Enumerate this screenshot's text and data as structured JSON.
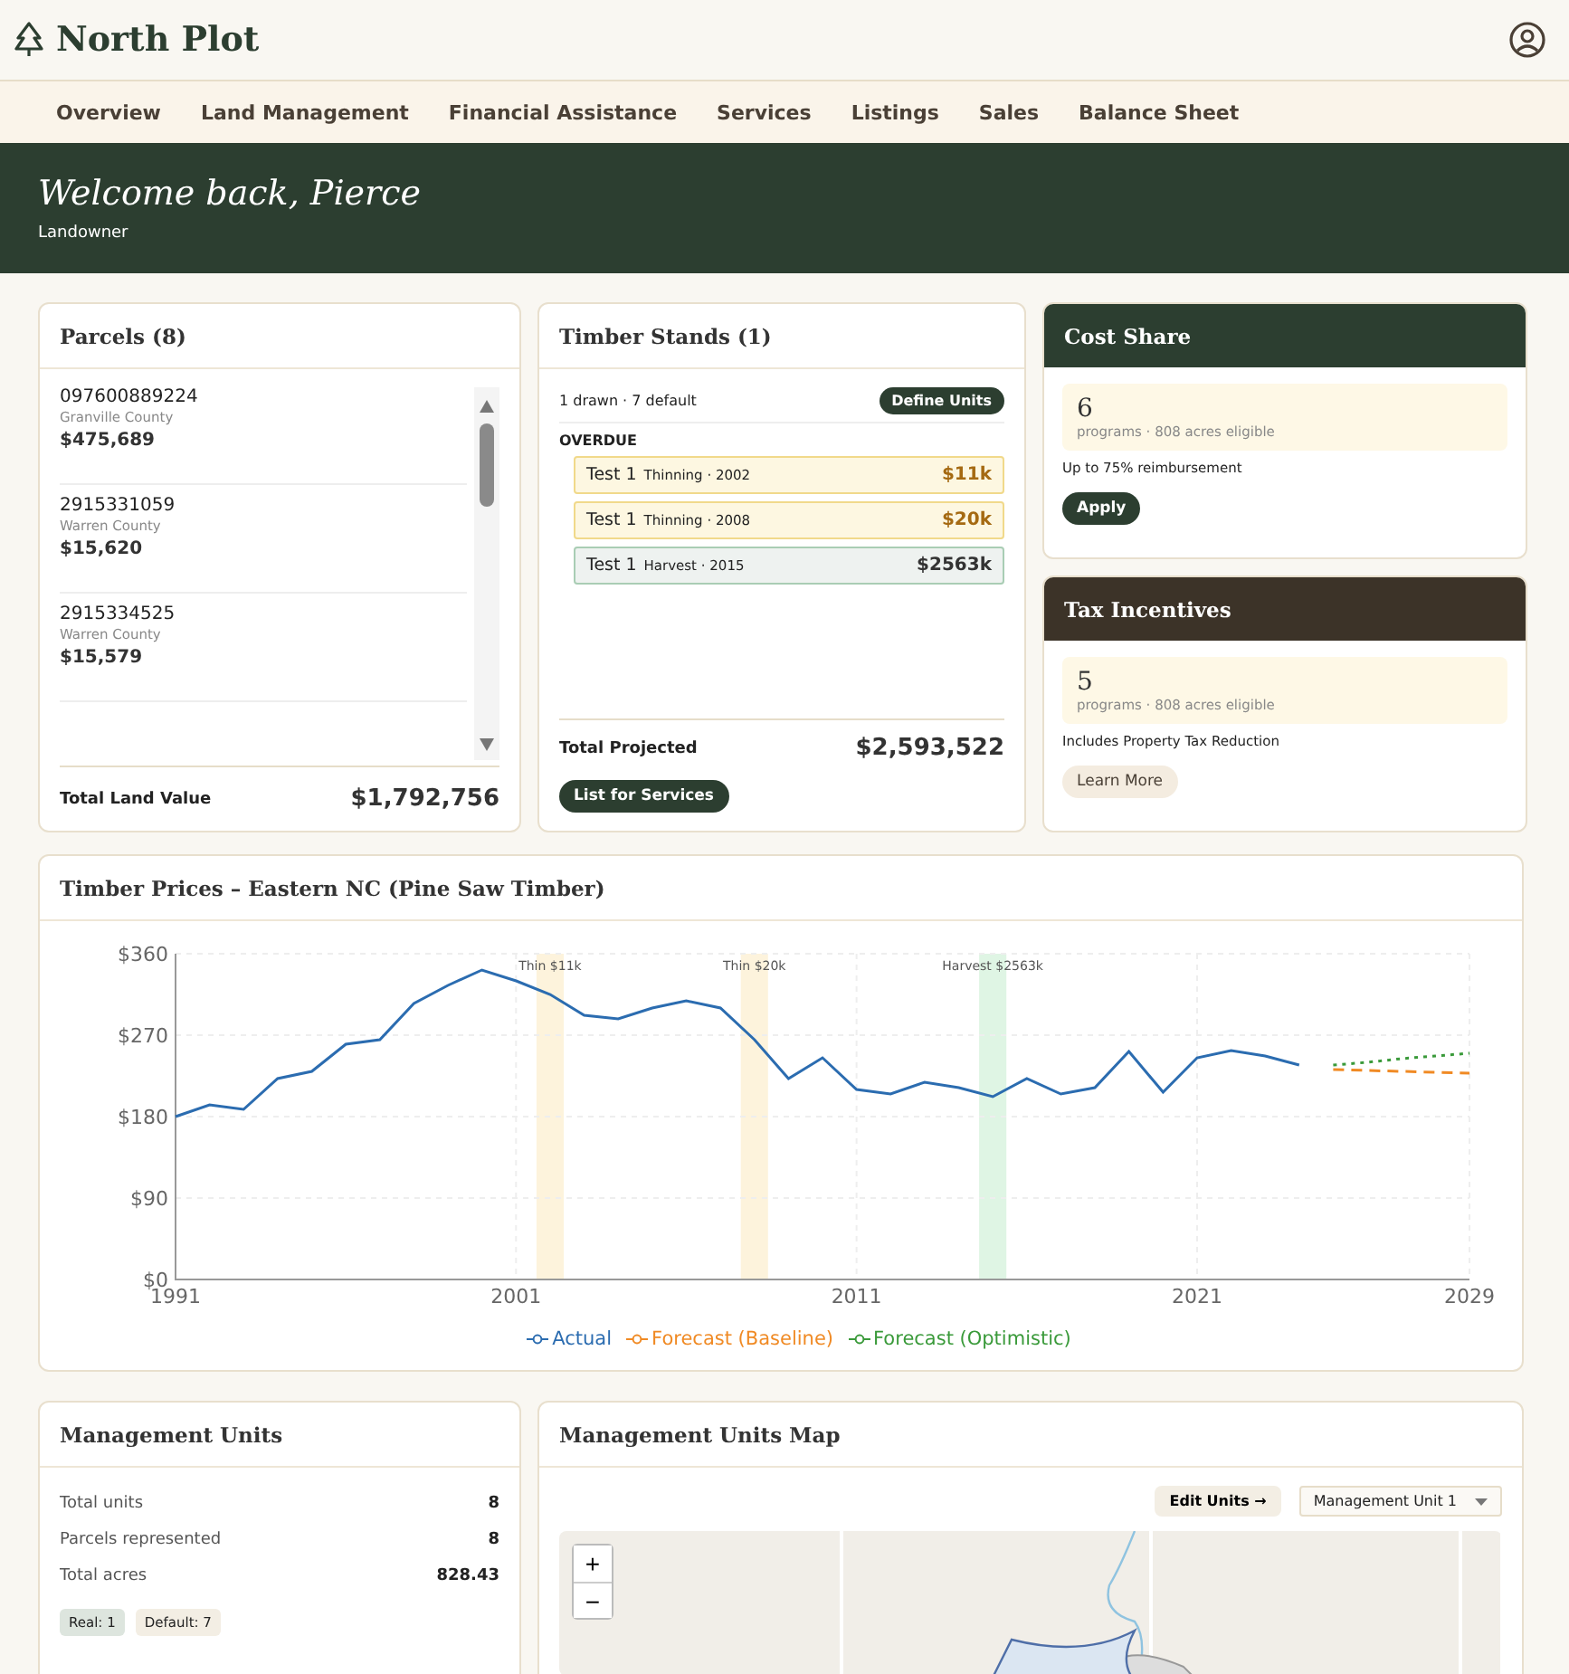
{
  "brand": "North Plot",
  "nav": [
    "Overview",
    "Land Management",
    "Financial Assistance",
    "Services",
    "Listings",
    "Sales",
    "Balance Sheet"
  ],
  "banner": {
    "title": "Welcome back, Pierce",
    "role": "Landowner"
  },
  "parcels": {
    "title": "Parcels (8)",
    "items": [
      {
        "id": "097600889224",
        "county": "Granville County",
        "value": "$475,689"
      },
      {
        "id": "2915331059",
        "county": "Warren County",
        "value": "$15,620"
      },
      {
        "id": "2915334525",
        "county": "Warren County",
        "value": "$15,579"
      }
    ],
    "total_label": "Total Land Value",
    "total": "$1,792,756"
  },
  "stands": {
    "title": "Timber Stands (1)",
    "summary": "1 drawn · 7 default",
    "define_button": "Define Units",
    "section": "OVERDUE",
    "items": [
      {
        "kind": "thinning",
        "name": "Test 1",
        "detail": "Thinning · 2002",
        "amount": "$11k"
      },
      {
        "kind": "thinning",
        "name": "Test 1",
        "detail": "Thinning · 2008",
        "amount": "$20k"
      },
      {
        "kind": "harvest",
        "name": "Test 1",
        "detail": "Harvest · 2015",
        "amount": "$2563k"
      }
    ],
    "total_label": "Total Projected",
    "total": "$2,593,522",
    "list_button": "List for Services"
  },
  "programs": [
    {
      "title": "Cost Share",
      "color": "#2c3e30",
      "count": "6",
      "caption": "programs · 808 acres eligible",
      "note": "Up to 75% reimbursement",
      "button": "Apply",
      "kind": "primary"
    },
    {
      "title": "Tax Incentives",
      "color": "#3c3328",
      "count": "5",
      "caption": "programs · 808 acres eligible",
      "note": "Includes Property Tax Reduction",
      "button": "Learn More",
      "kind": "secondary"
    }
  ],
  "prices": {
    "title": "Timber Prices – Eastern NC (Pine Saw Timber)",
    "chart_data": {
      "type": "line",
      "x": [
        1991,
        1992,
        1993,
        1994,
        1995,
        1996,
        1997,
        1998,
        1999,
        2000,
        2001,
        2002,
        2003,
        2004,
        2005,
        2006,
        2007,
        2008,
        2009,
        2010,
        2011,
        2012,
        2013,
        2014,
        2015,
        2016,
        2017,
        2018,
        2019,
        2020,
        2021,
        2022,
        2023,
        2024,
        2025,
        2026,
        2027,
        2028,
        2029
      ],
      "series": [
        {
          "name": "Actual",
          "color": "#2b6cb0",
          "line_style": "solid",
          "values": [
            180,
            193,
            188,
            222,
            230,
            260,
            265,
            305,
            325,
            342,
            330,
            315,
            292,
            288,
            300,
            308,
            300,
            265,
            222,
            245,
            210,
            205,
            218,
            212,
            202,
            222,
            205,
            212,
            252,
            207,
            245,
            253,
            247,
            237,
            null,
            null,
            null,
            null,
            null
          ]
        },
        {
          "name": "Forecast (Baseline)",
          "color": "#f08a24",
          "line_style": "dashed",
          "values": [
            null,
            null,
            null,
            null,
            null,
            null,
            null,
            null,
            null,
            null,
            null,
            null,
            null,
            null,
            null,
            null,
            null,
            null,
            null,
            null,
            null,
            null,
            null,
            null,
            null,
            null,
            null,
            null,
            null,
            null,
            null,
            null,
            null,
            null,
            232,
            231,
            230,
            229,
            228
          ]
        },
        {
          "name": "Forecast (Optimistic)",
          "color": "#3a9a3a",
          "line_style": "dotted",
          "values": [
            null,
            null,
            null,
            null,
            null,
            null,
            null,
            null,
            null,
            null,
            null,
            null,
            null,
            null,
            null,
            null,
            null,
            null,
            null,
            null,
            null,
            null,
            null,
            null,
            null,
            null,
            null,
            null,
            null,
            null,
            null,
            null,
            null,
            null,
            237,
            240,
            244,
            247,
            250
          ]
        }
      ],
      "xlim": [
        1991,
        2029
      ],
      "ylim": [
        0,
        360
      ],
      "xticks": [
        1991,
        2001,
        2011,
        2021,
        2029
      ],
      "yticks": [
        {
          "value": 0,
          "label": "$0"
        },
        {
          "value": 90,
          "label": "$90"
        },
        {
          "value": 180,
          "label": "$180"
        },
        {
          "value": 270,
          "label": "$270"
        },
        {
          "value": 360,
          "label": "$360"
        }
      ],
      "grid": true,
      "legend": "bottom",
      "bands": [
        {
          "axis": "x",
          "from": 2001.6,
          "to": 2002.4,
          "label": "Thin $11k",
          "color": "#fdf3dc"
        },
        {
          "axis": "x",
          "from": 2007.6,
          "to": 2008.4,
          "label": "Thin $20k",
          "color": "#fdf3dc"
        },
        {
          "axis": "x",
          "from": 2014.6,
          "to": 2015.4,
          "label": "Harvest $2563k",
          "color": "#dff5e4"
        }
      ]
    }
  },
  "units": {
    "title": "Management Units",
    "stats": [
      {
        "label": "Total units",
        "value": "8"
      },
      {
        "label": "Parcels represented",
        "value": "8"
      },
      {
        "label": "Total acres",
        "value": "828.43"
      }
    ],
    "tags": [
      {
        "label": "Real: 1",
        "color": "#dde5de"
      },
      {
        "label": "Default: 7",
        "color": "#f3eee4"
      }
    ]
  },
  "map": {
    "title": "Management Units Map",
    "edit_button": "Edit Units →",
    "unit_select": "Management Unit 1",
    "zoom_in": "+",
    "zoom_out": "−"
  }
}
